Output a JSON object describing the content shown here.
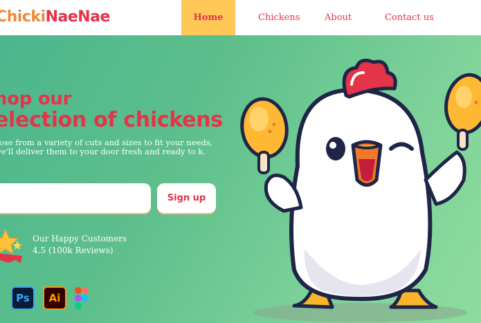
{
  "brand": {
    "logo_part1": "Chicki",
    "logo_part2": "NaeNae"
  },
  "nav": {
    "items": [
      {
        "label": "Home",
        "active": true
      },
      {
        "label": "Chickens",
        "active": false
      },
      {
        "label": "About",
        "active": false
      },
      {
        "label": "Contact us",
        "active": false
      }
    ]
  },
  "hero": {
    "heading_line1": "hop our",
    "heading_line2": "election of chickens",
    "description": "oose from a variety of cuts and sizes to fit your needs, we'll deliver them to your door fresh and ready to k."
  },
  "signup": {
    "email_value": "",
    "button_label": "Sign up"
  },
  "customers": {
    "title": "Our Happy Customers",
    "rating": "4.5 (100k Reviews)"
  },
  "tools": [
    {
      "icon": "photoshop-icon",
      "label": "Ps"
    },
    {
      "icon": "illustrator-icon",
      "label": "Ai"
    },
    {
      "icon": "figma-icon",
      "label": ""
    }
  ],
  "colors": {
    "accent_red": "#e3344a",
    "nav_active_bg": "#ffc857",
    "logo_orange": "#f0893a",
    "hero_green": "#5ebf8c"
  }
}
